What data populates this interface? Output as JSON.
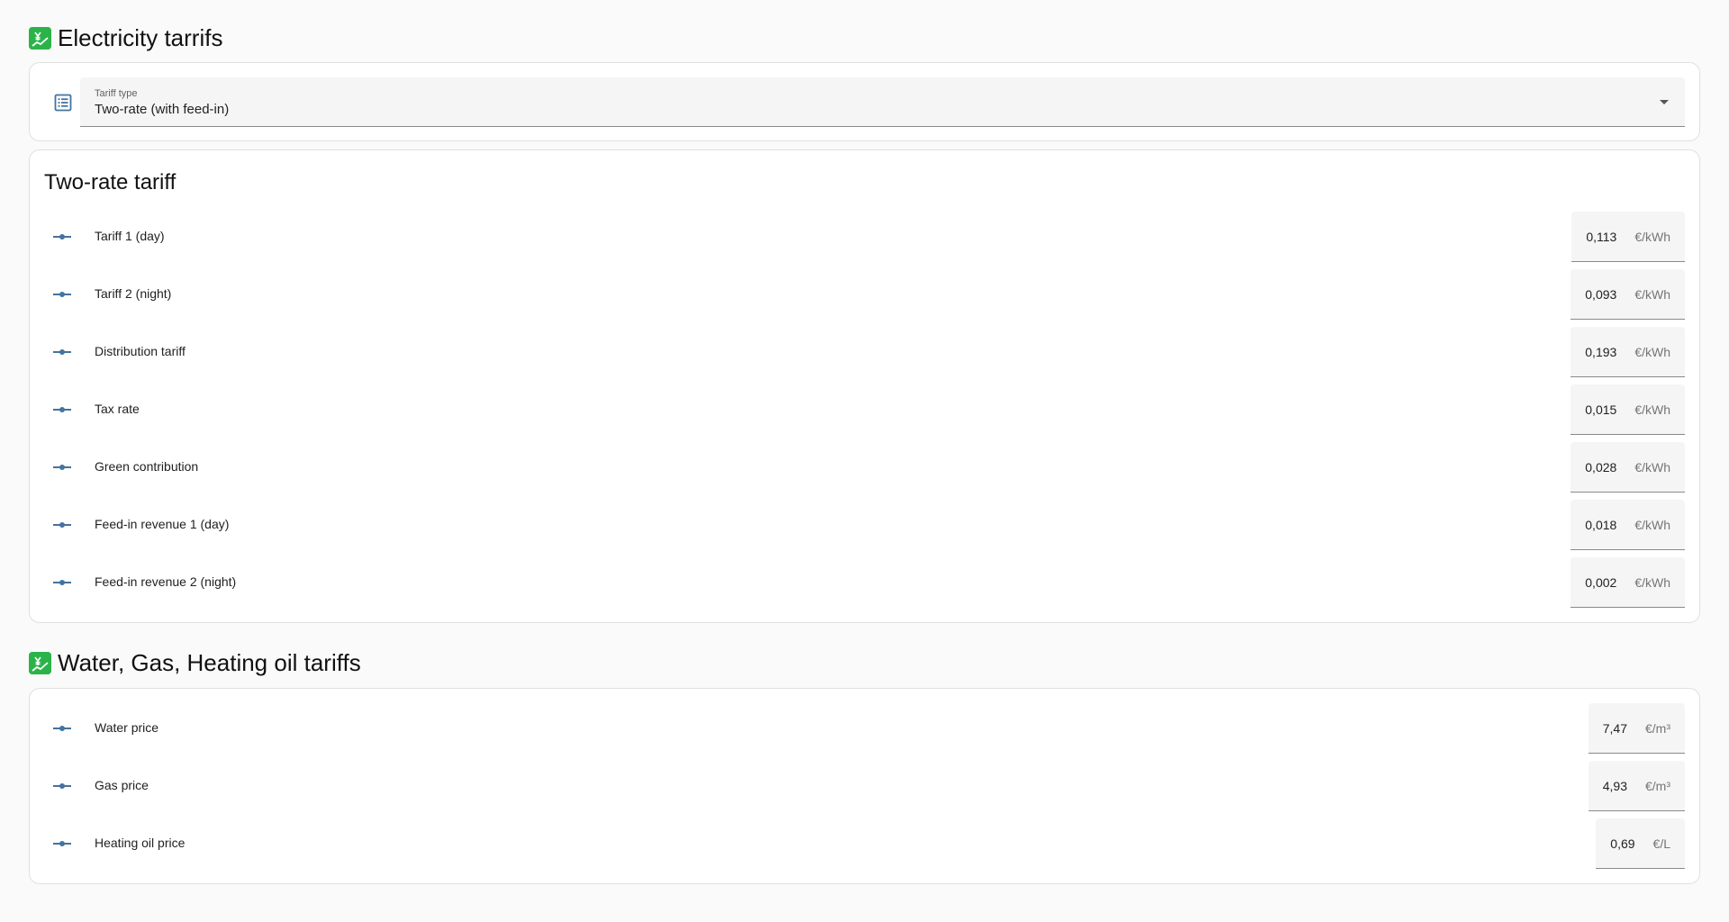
{
  "sections": {
    "electricity_title": "Electricity tarrifs",
    "utility_title": "Water, Gas, Heating oil tariffs",
    "title_icon": "chart-increasing-yen-icon"
  },
  "tariff_type": {
    "label": "Tariff type",
    "value": "Two-rate (with feed-in)",
    "icon": "list-icon"
  },
  "two_rate": {
    "header": "Two-rate tariff",
    "rows": [
      {
        "label": "Tariff 1 (day)",
        "value": "0,113",
        "unit": "€/kWh"
      },
      {
        "label": "Tariff 2 (night)",
        "value": "0,093",
        "unit": "€/kWh"
      },
      {
        "label": "Distribution tariff",
        "value": "0,193",
        "unit": "€/kWh"
      },
      {
        "label": "Tax rate",
        "value": "0,015",
        "unit": "€/kWh"
      },
      {
        "label": "Green contribution",
        "value": "0,028",
        "unit": "€/kWh"
      },
      {
        "label": "Feed-in revenue 1 (day)",
        "value": "0,018",
        "unit": "€/kWh"
      },
      {
        "label": "Feed-in revenue 2 (night)",
        "value": "0,002",
        "unit": "€/kWh"
      }
    ]
  },
  "utilities": {
    "rows": [
      {
        "label": "Water price",
        "value": "7,47",
        "unit": "€/m³"
      },
      {
        "label": "Gas price",
        "value": "4,93",
        "unit": "€/m³"
      },
      {
        "label": "Heating oil price",
        "value": "0,69",
        "unit": "€/L"
      }
    ]
  },
  "colors": {
    "accent": "#44739e",
    "emoji_bg": "#2bb34a",
    "field_bg": "#f5f5f5"
  }
}
